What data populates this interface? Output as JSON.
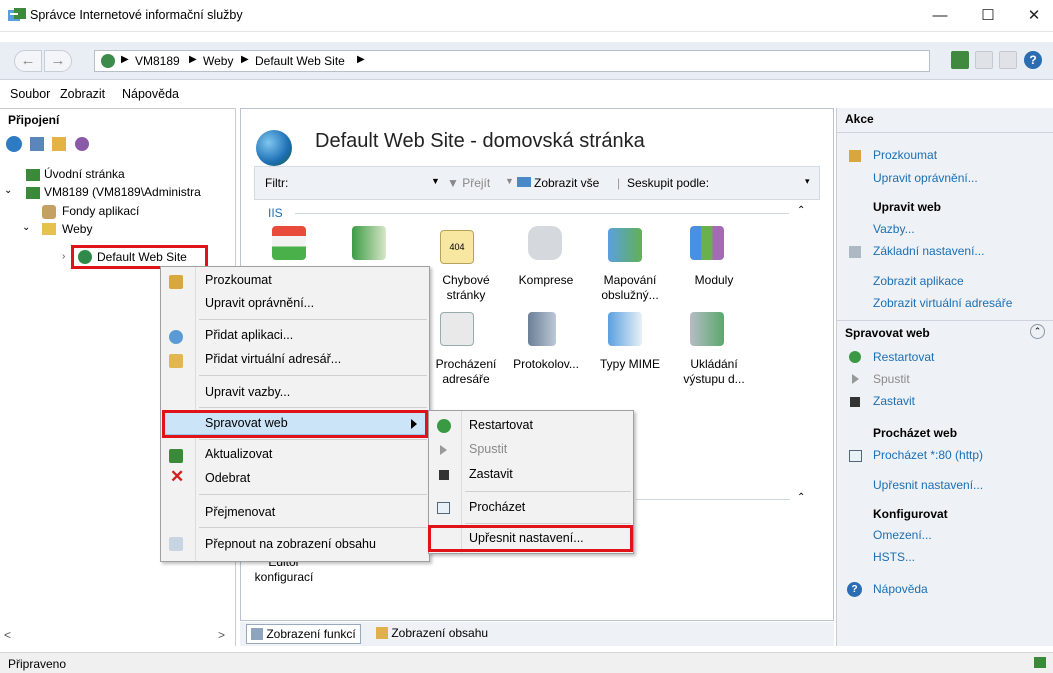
{
  "window": {
    "title": "Správce Internetové informační služby"
  },
  "address": {
    "crumbs": [
      "VM8189",
      "Weby",
      "Default Web Site"
    ]
  },
  "menu": [
    "Soubor",
    "Zobrazit",
    "Nápověda"
  ],
  "connections": {
    "header": "Připojení",
    "tree": [
      "Úvodní stránka",
      "VM8189 (VM8189\\Administra",
      "Fondy aplikací",
      "Weby",
      "Default Web Site"
    ]
  },
  "center": {
    "title": "Default Web Site - domovská stránka",
    "filter_label": "Filtr:",
    "go": "Přejít",
    "show_all": "Zobrazit vše",
    "group_by": "Seskupit podle:",
    "group_iis": "IIS",
    "features": [
      [
        "Chybové",
        "stránky"
      ],
      [
        "Komprese"
      ],
      [
        "Mapování",
        "obslužný..."
      ],
      [
        "Moduly"
      ],
      [
        "Procházení",
        "adresáře"
      ],
      [
        "Protokolov..."
      ],
      [
        "Typy MIME"
      ],
      [
        "Ukládání",
        "výstupu d..."
      ]
    ],
    "editor": [
      "Editor",
      "konfigurací"
    ],
    "tabs": [
      "Zobrazení funkcí",
      "Zobrazení obsahu"
    ]
  },
  "actions": {
    "header": "Akce",
    "explore": "Prozkoumat",
    "edit_perms": "Upravit oprávnění...",
    "edit_site": "Upravit web",
    "bindings": "Vazby...",
    "basic": "Základní nastavení...",
    "view_apps": "Zobrazit aplikace",
    "view_vdirs": "Zobrazit virtuální adresáře",
    "manage": "Spravovat web",
    "restart": "Restartovat",
    "start": "Spustit",
    "stop": "Zastavit",
    "browse_head": "Procházet web",
    "browse": "Procházet *:80 (http)",
    "advanced": "Upřesnit nastavení...",
    "configure": "Konfigurovat",
    "limits": "Omezení...",
    "hsts": "HSTS...",
    "help": "Nápověda"
  },
  "context_menu": {
    "items": [
      "Prozkoumat",
      "Upravit oprávnění...",
      "Přidat aplikaci...",
      "Přidat virtuální adresář...",
      "Upravit vazby...",
      "Spravovat web",
      "Aktualizovat",
      "Odebrat",
      "Přejmenovat",
      "Přepnout na zobrazení obsahu"
    ]
  },
  "submenu": {
    "items": [
      "Restartovat",
      "Spustit",
      "Zastavit",
      "Procházet",
      "Upřesnit nastavení..."
    ]
  },
  "status": "Připraveno",
  "colors": {
    "link": "#1a6fb6",
    "highlight": "#cce4f7",
    "red_outline": "#e01418"
  }
}
